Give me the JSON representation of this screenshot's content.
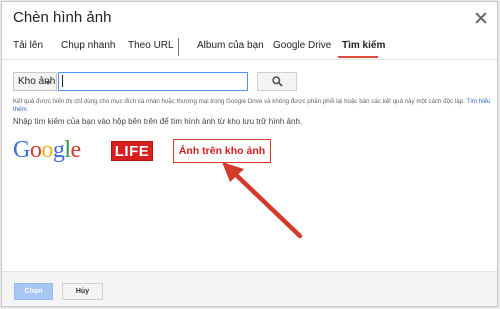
{
  "dialog": {
    "title": "Chèn hình ảnh"
  },
  "tabs": [
    {
      "label": "Tải lên"
    },
    {
      "label": "Chụp nhanh"
    },
    {
      "label": "Theo URL"
    },
    {
      "label": "Album của bạn"
    },
    {
      "label": "Google Drive"
    },
    {
      "label": "Tìm kiếm"
    }
  ],
  "active_tab": "Tìm kiếm",
  "search": {
    "source_label": "Kho ảnh",
    "query_value": "",
    "button_icon": "magnifier-icon"
  },
  "notice": {
    "text": "Kết quả được hiển thị chỉ dùng cho mục đích cá nhân hoặc thương mại trong Google Drive và không được phân phối lại hoặc bán các kết quả này một cách độc lập.",
    "link": "Tìm hiểu thêm"
  },
  "prompt": "Nhập tìm kiếm của bạn vào hộp bên trên để tìm hình ảnh từ kho lưu trữ hình ảnh.",
  "sources": {
    "google_logo": "Google",
    "life_logo": "LIFE",
    "library_label": "Ảnh trên kho ảnh"
  },
  "footer": {
    "choose_label": "Chọn",
    "cancel_label": "Hủy"
  },
  "colors": {
    "accent_red": "#dd4b39",
    "annotation_red": "#d63b2b",
    "primary_disabled": "#a9c7f5",
    "input_focus": "#4d90fe"
  }
}
